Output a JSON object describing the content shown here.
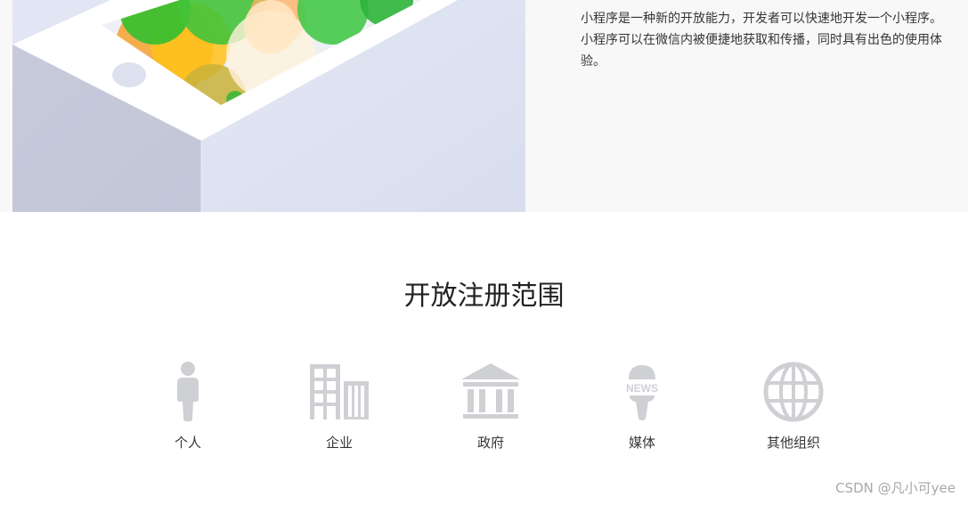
{
  "intro": {
    "description": "小程序是一种新的开放能力，开发者可以快速地开发一个小程序。小程序可以在微信内被便捷地获取和传播，同时具有出色的使用体验。"
  },
  "registration_scope": {
    "title": "开放注册范围",
    "items": [
      {
        "label": "个人",
        "icon": "person-icon"
      },
      {
        "label": "企业",
        "icon": "enterprise-building-icon"
      },
      {
        "label": "政府",
        "icon": "government-building-icon"
      },
      {
        "label": "媒体",
        "icon": "news-microphone-icon"
      },
      {
        "label": "其他组织",
        "icon": "globe-icon"
      }
    ],
    "news_icon_text": "NEWS"
  },
  "watermark": {
    "text": "CSDN @凡小可yee"
  },
  "colors": {
    "icon_gray": "#cfd0d4",
    "band_background": "#f8f8f8"
  }
}
